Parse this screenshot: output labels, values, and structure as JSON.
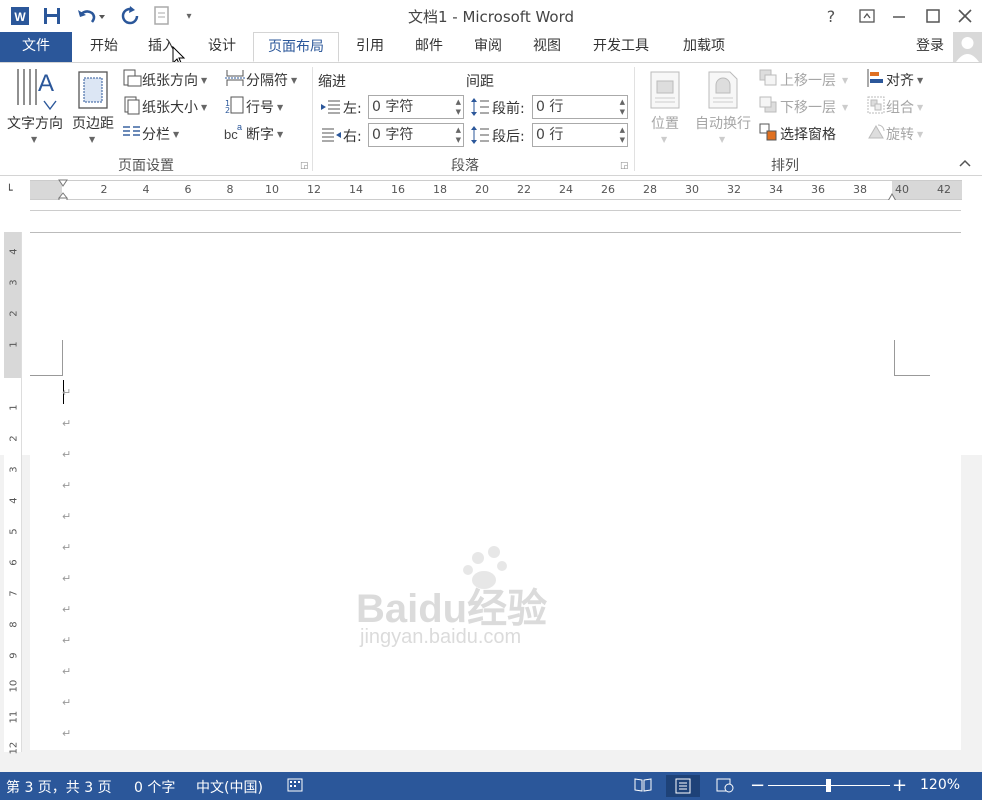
{
  "title": "文档1 - Microsoft Word",
  "help": "?",
  "tabs": [
    {
      "id": "file",
      "label": "文件"
    },
    {
      "id": "home",
      "label": "开始"
    },
    {
      "id": "insert",
      "label": "插入"
    },
    {
      "id": "design",
      "label": "设计"
    },
    {
      "id": "layout",
      "label": "页面布局"
    },
    {
      "id": "references",
      "label": "引用"
    },
    {
      "id": "mailings",
      "label": "邮件"
    },
    {
      "id": "review",
      "label": "审阅"
    },
    {
      "id": "view",
      "label": "视图"
    },
    {
      "id": "developer",
      "label": "开发工具"
    },
    {
      "id": "addins",
      "label": "加载项"
    }
  ],
  "signin": "登录",
  "page_setup": {
    "text_direction": "文字方向",
    "margins": "页边距",
    "orientation": "纸张方向",
    "size": "纸张大小",
    "columns": "分栏",
    "breaks": "分隔符",
    "line_numbers": "行号",
    "hyphenation": "断字",
    "group_label": "页面设置"
  },
  "paragraph": {
    "indent_title": "缩进",
    "spacing_title": "间距",
    "left_label": "左:",
    "right_label": "右:",
    "before_label": "段前:",
    "after_label": "段后:",
    "left_value": "0 字符",
    "right_value": "0 字符",
    "before_value": "0 行",
    "after_value": "0 行",
    "group_label": "段落"
  },
  "arrange": {
    "position": "位置",
    "wrap_text": "自动换行",
    "bring_forward": "上移一层",
    "send_backward": "下移一层",
    "selection_pane": "选择窗格",
    "align": "对齐",
    "group": "组合",
    "rotate": "旋转",
    "group_label": "排列"
  },
  "ruler_numbers": [
    "2",
    "4",
    "6",
    "8",
    "10",
    "12",
    "14",
    "16",
    "18",
    "20",
    "22",
    "24",
    "26",
    "28",
    "30",
    "32",
    "34",
    "36",
    "38",
    "40",
    "42"
  ],
  "vruler_top": [
    "4",
    "3",
    "2",
    "1"
  ],
  "vruler_bottom": [
    "1",
    "2",
    "3",
    "4",
    "5",
    "6",
    "7",
    "8",
    "9",
    "10",
    "11",
    "12"
  ],
  "watermark": {
    "brand": "Baidu经验",
    "url": "jingyan.baidu.com"
  },
  "status": {
    "page": "第 3 页，共 3 页",
    "words": "0 个字",
    "language": "中文(中国)",
    "zoom": "120%"
  },
  "colors": {
    "accent": "#2b579a",
    "doc_bg": "#f2f2f2"
  }
}
